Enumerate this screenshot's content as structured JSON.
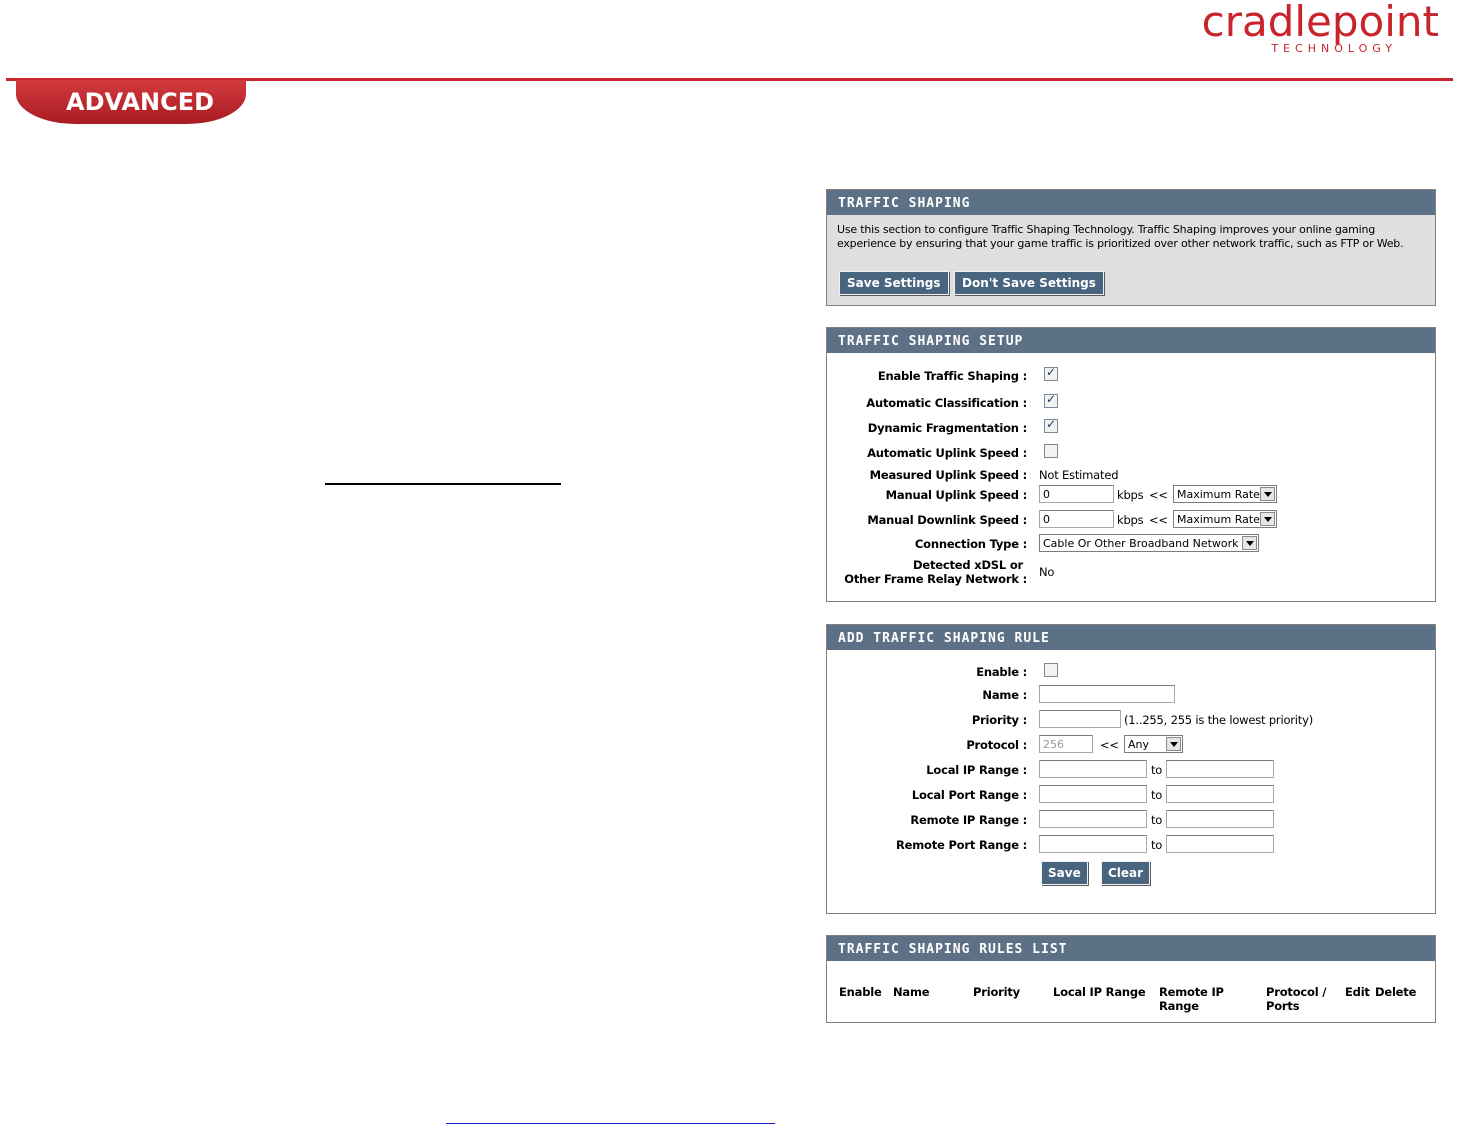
{
  "brand": {
    "logo_word": "cradlepoint",
    "logo_sub": "TECHNOLOGY",
    "section_tab": "ADVANCED"
  },
  "traffic_shaping": {
    "title": "TRAFFIC SHAPING",
    "description": "Use this section to configure Traffic Shaping Technology. Traffic Shaping improves your online gaming experience by ensuring that your game traffic is prioritized over other network traffic, such as FTP or Web.",
    "save_label": "Save Settings",
    "dont_save_label": "Don't Save Settings"
  },
  "setup": {
    "title": "TRAFFIC SHAPING SETUP",
    "enable_label": "Enable Traffic Shaping :",
    "enable_checked": true,
    "auto_class_label": "Automatic Classification :",
    "auto_class_checked": true,
    "dyn_frag_label": "Dynamic Fragmentation :",
    "dyn_frag_checked": true,
    "auto_uplink_label": "Automatic Uplink Speed :",
    "auto_uplink_checked": false,
    "measured_label": "Measured Uplink Speed :",
    "measured_value": "Not Estimated",
    "manual_up_label": "Manual Uplink Speed :",
    "manual_up_value": "0",
    "manual_up_unit": "kbps",
    "manual_up_arrow": "<<",
    "manual_up_select": "Maximum Rate",
    "manual_down_label": "Manual Downlink Speed :",
    "manual_down_value": "0",
    "manual_down_unit": "kbps",
    "manual_down_arrow": "<<",
    "manual_down_select": "Maximum Rate",
    "conn_type_label": "Connection Type :",
    "conn_type_select": "Cable Or Other Broadband Network",
    "detected_label_1": "Detected xDSL or",
    "detected_label_2": "Other Frame Relay Network :",
    "detected_value": "No"
  },
  "add_rule": {
    "title": "ADD TRAFFIC SHAPING RULE",
    "enable_label": "Enable :",
    "enable_checked": false,
    "name_label": "Name :",
    "name_value": "",
    "priority_label": "Priority :",
    "priority_value": "",
    "priority_hint": "(1..255, 255 is the lowest priority)",
    "protocol_label": "Protocol :",
    "protocol_value": "256",
    "protocol_arrow": "<<",
    "protocol_select": "Any",
    "local_ip_label": "Local IP Range :",
    "local_port_label": "Local Port Range :",
    "remote_ip_label": "Remote IP Range :",
    "remote_port_label": "Remote Port Range :",
    "to_label": "to",
    "save_label": "Save",
    "clear_label": "Clear"
  },
  "rules_list": {
    "title": "TRAFFIC SHAPING RULES LIST",
    "col_enable": "Enable",
    "col_name": "Name",
    "col_priority": "Priority",
    "col_local_ip": "Local IP Range",
    "col_remote_ip_1": "Remote IP",
    "col_remote_ip_2": "Range",
    "col_protocol_1": "Protocol /",
    "col_protocol_2": "Ports",
    "col_edit": "Edit",
    "col_delete": "Delete"
  },
  "colors": {
    "brand_red": "#c8242b",
    "panel_header": "#5d7186",
    "button": "#48647e"
  }
}
